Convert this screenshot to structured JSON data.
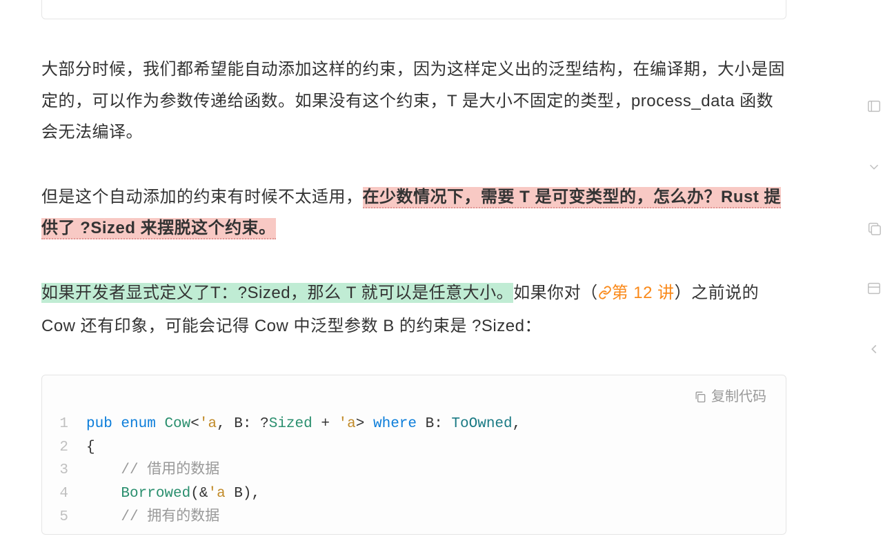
{
  "paragraphs": {
    "p1": "大部分时候，我们都希望能自动添加这样的约束，因为这样定义出的泛型结构，在编译期，大小是固定的，可以作为参数传递给函数。如果没有这个约束，T 是大小不固定的类型，process_data 函数会无法编译。",
    "p2_plain": "但是这个自动添加的约束有时候不太适用，",
    "p2_highlight": "在少数情况下，需要 T 是可变类型的，怎么办？Rust 提供了 ?Sized 来摆脱这个约束。",
    "p3_green": "如果开发者显式定义了T：?Sized，那么 T 就可以是任意大小。",
    "p3_after_green": "如果你对（",
    "p3_link": "第 12 讲",
    "p3_tail": "）之前说的 Cow 还有印象，可能会记得 Cow 中泛型参数 B 的约束是 ?Sized："
  },
  "copy_label": "复制代码",
  "code": {
    "l1": {
      "kw_pub": "pub",
      "kw_enum": "enum",
      "type_cow": "Cow",
      "lt": "<",
      "life_a1": "'a",
      "comma_b": ", B: ",
      "q": "?",
      "sized": "Sized",
      "plus": " + ",
      "life_a2": "'a",
      "gt": ">",
      "sp": " ",
      "kw_where": "where",
      "b_colon": " B: ",
      "toowned": "ToOwned",
      "comma": ","
    },
    "l2": "{",
    "l3": {
      "indent": "    ",
      "cmt": "// 借用的数据"
    },
    "l4": {
      "indent": "    ",
      "borrowed": "Borrowed",
      "open": "(&",
      "life_a": "'a",
      "sp": " B),"
    },
    "l5": {
      "indent": "    ",
      "cmt": "// 拥有的数据"
    }
  }
}
